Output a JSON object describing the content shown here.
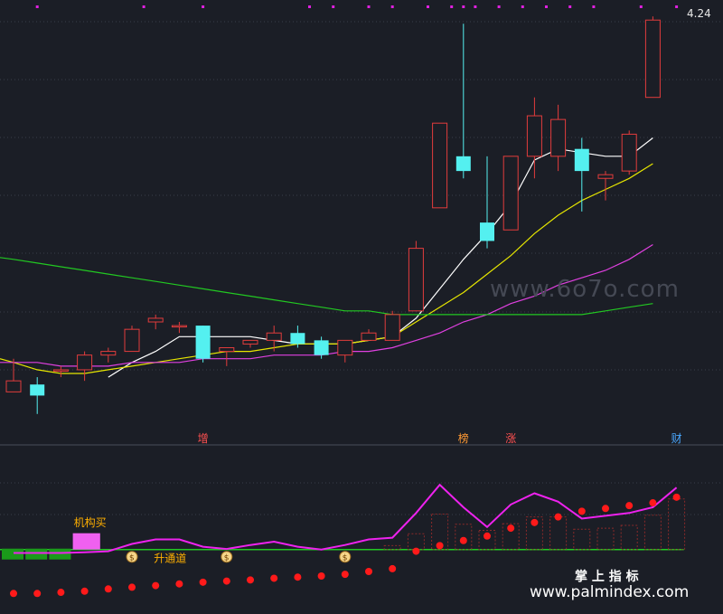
{
  "chart_data": [
    {
      "type": "candlestick",
      "title": "",
      "last_price_label": "4.24",
      "candles": [
        {
          "o": 3.22,
          "h": 3.31,
          "l": 3.22,
          "c": 3.25
        },
        {
          "o": 3.24,
          "h": 3.26,
          "l": 3.16,
          "c": 3.21
        },
        {
          "o": 3.28,
          "h": 3.29,
          "l": 3.26,
          "c": 3.28
        },
        {
          "o": 3.28,
          "h": 3.33,
          "l": 3.25,
          "c": 3.32
        },
        {
          "o": 3.32,
          "h": 3.34,
          "l": 3.3,
          "c": 3.33
        },
        {
          "o": 3.33,
          "h": 3.4,
          "l": 3.33,
          "c": 3.39
        },
        {
          "o": 3.41,
          "h": 3.43,
          "l": 3.39,
          "c": 3.42
        },
        {
          "o": 3.4,
          "h": 3.41,
          "l": 3.38,
          "c": 3.4
        },
        {
          "o": 3.4,
          "h": 3.4,
          "l": 3.3,
          "c": 3.31
        },
        {
          "o": 3.33,
          "h": 3.34,
          "l": 3.29,
          "c": 3.34
        },
        {
          "o": 3.35,
          "h": 3.36,
          "l": 3.34,
          "c": 3.36
        },
        {
          "o": 3.36,
          "h": 3.4,
          "l": 3.33,
          "c": 3.38
        },
        {
          "o": 3.38,
          "h": 3.4,
          "l": 3.34,
          "c": 3.35
        },
        {
          "o": 3.36,
          "h": 3.37,
          "l": 3.31,
          "c": 3.32
        },
        {
          "o": 3.32,
          "h": 3.36,
          "l": 3.3,
          "c": 3.36
        },
        {
          "o": 3.36,
          "h": 3.39,
          "l": 3.36,
          "c": 3.38
        },
        {
          "o": 3.36,
          "h": 3.44,
          "l": 3.36,
          "c": 3.43
        },
        {
          "o": 3.44,
          "h": 3.63,
          "l": 3.44,
          "c": 3.61
        },
        {
          "o": 3.72,
          "h": 3.95,
          "l": 3.72,
          "c": 3.95
        },
        {
          "o": 3.86,
          "h": 4.22,
          "l": 3.8,
          "c": 3.82
        },
        {
          "o": 3.68,
          "h": 3.86,
          "l": 3.61,
          "c": 3.63
        },
        {
          "o": 3.66,
          "h": 3.86,
          "l": 3.66,
          "c": 3.86
        },
        {
          "o": 3.86,
          "h": 4.02,
          "l": 3.8,
          "c": 3.97
        },
        {
          "o": 3.86,
          "h": 4.0,
          "l": 3.82,
          "c": 3.96
        },
        {
          "o": 3.88,
          "h": 3.91,
          "l": 3.71,
          "c": 3.82
        },
        {
          "o": 3.8,
          "h": 3.82,
          "l": 3.74,
          "c": 3.81
        },
        {
          "o": 3.82,
          "h": 3.93,
          "l": 3.81,
          "c": 3.92
        },
        {
          "o": 4.02,
          "h": 4.24,
          "l": 4.02,
          "c": 4.23
        }
      ],
      "ma_lines": [
        {
          "color": "#ffffff",
          "values": [
            null,
            null,
            null,
            null,
            3.26,
            3.3,
            3.33,
            3.37,
            3.37,
            3.37,
            3.37,
            3.36,
            3.35,
            3.35,
            3.35,
            3.36,
            3.37,
            3.42,
            3.5,
            3.58,
            3.65,
            3.73,
            3.85,
            3.88,
            3.87,
            3.86,
            3.86,
            3.91
          ]
        },
        {
          "color": "#e6e600",
          "values": [
            3.3,
            3.28,
            3.27,
            3.27,
            3.28,
            3.29,
            3.3,
            3.31,
            3.32,
            3.33,
            3.33,
            3.34,
            3.35,
            3.35,
            3.35,
            3.36,
            3.37,
            3.41,
            3.45,
            3.49,
            3.54,
            3.59,
            3.65,
            3.7,
            3.74,
            3.77,
            3.8,
            3.84
          ]
        },
        {
          "color": "#e040e0",
          "values": [
            3.3,
            3.3,
            3.29,
            3.29,
            3.29,
            3.3,
            3.3,
            3.3,
            3.31,
            3.31,
            3.31,
            3.32,
            3.32,
            3.32,
            3.33,
            3.33,
            3.34,
            3.36,
            3.38,
            3.41,
            3.43,
            3.46,
            3.48,
            3.51,
            3.53,
            3.55,
            3.58,
            3.62
          ]
        },
        {
          "color": "#22c822",
          "values": [
            3.58,
            3.57,
            3.56,
            3.55,
            3.54,
            3.53,
            3.52,
            3.51,
            3.5,
            3.49,
            3.48,
            3.47,
            3.46,
            3.45,
            3.44,
            3.44,
            3.43,
            3.43,
            3.43,
            3.43,
            3.43,
            3.43,
            3.43,
            3.43,
            3.43,
            3.44,
            3.45,
            3.46
          ]
        }
      ],
      "event_markers": [
        {
          "index": 8,
          "text": "增",
          "color": "#ff5050"
        },
        {
          "index": 19,
          "text": "榜",
          "color": "#ff9933"
        },
        {
          "index": 21,
          "text": "涨",
          "color": "#ff5050"
        },
        {
          "index": 28,
          "text": "财",
          "color": "#4aa8ff"
        }
      ],
      "top_dots": [
        2,
        11,
        16,
        25,
        27,
        30,
        32,
        35,
        37,
        38,
        39,
        41,
        43,
        45,
        47,
        49,
        53,
        56,
        64,
        68,
        70,
        72
      ],
      "ylim": [
        3.13,
        4.26
      ],
      "watermark": "www.6o7o.com"
    },
    {
      "type": "indicator",
      "line": {
        "color": "#ee22ee",
        "values": [
          -0.6,
          -0.6,
          -0.6,
          -0.5,
          -0.3,
          1.0,
          1.8,
          1.8,
          0.5,
          0.1,
          0.8,
          1.4,
          0.5,
          0.0,
          0.8,
          1.8,
          2.1,
          6.5,
          11.5,
          7.5,
          4.0,
          8.0,
          10.0,
          8.5,
          5.5,
          6.0,
          6.5,
          7.5,
          11.0
        ]
      },
      "bars": [
        0,
        0,
        0,
        0,
        0,
        0,
        0,
        0,
        0,
        0,
        0,
        0,
        0,
        0,
        0,
        0,
        0.7,
        2.8,
        6.3,
        4.5,
        3.4,
        4.6,
        5.8,
        5.8,
        3.6,
        3.8,
        4.3,
        6.1,
        9.0
      ],
      "dots": [
        -7.8,
        -7.8,
        -7.6,
        -7.4,
        -7.0,
        -6.7,
        -6.4,
        -6.1,
        -5.8,
        -5.6,
        -5.4,
        -5.1,
        -4.9,
        -4.7,
        -4.4,
        -3.9,
        -3.4,
        -0.3,
        0.7,
        1.6,
        2.4,
        3.8,
        4.8,
        5.8,
        6.8,
        7.3,
        7.8,
        8.3,
        9.3
      ],
      "pink_block": {
        "start": 3,
        "end": 4
      },
      "text_labels": [
        {
          "text": "机构买",
          "index": 3,
          "color": "#ffb000"
        },
        {
          "text": "升通道",
          "index": 6,
          "color": "#ffb000"
        }
      ],
      "money_bag_indices": [
        5,
        9,
        14
      ],
      "ylim": [
        -9.2,
        16.5
      ]
    }
  ],
  "footer": {
    "brand_cn": "掌 上 指 标",
    "brand_url": "www.palmindex.com"
  }
}
